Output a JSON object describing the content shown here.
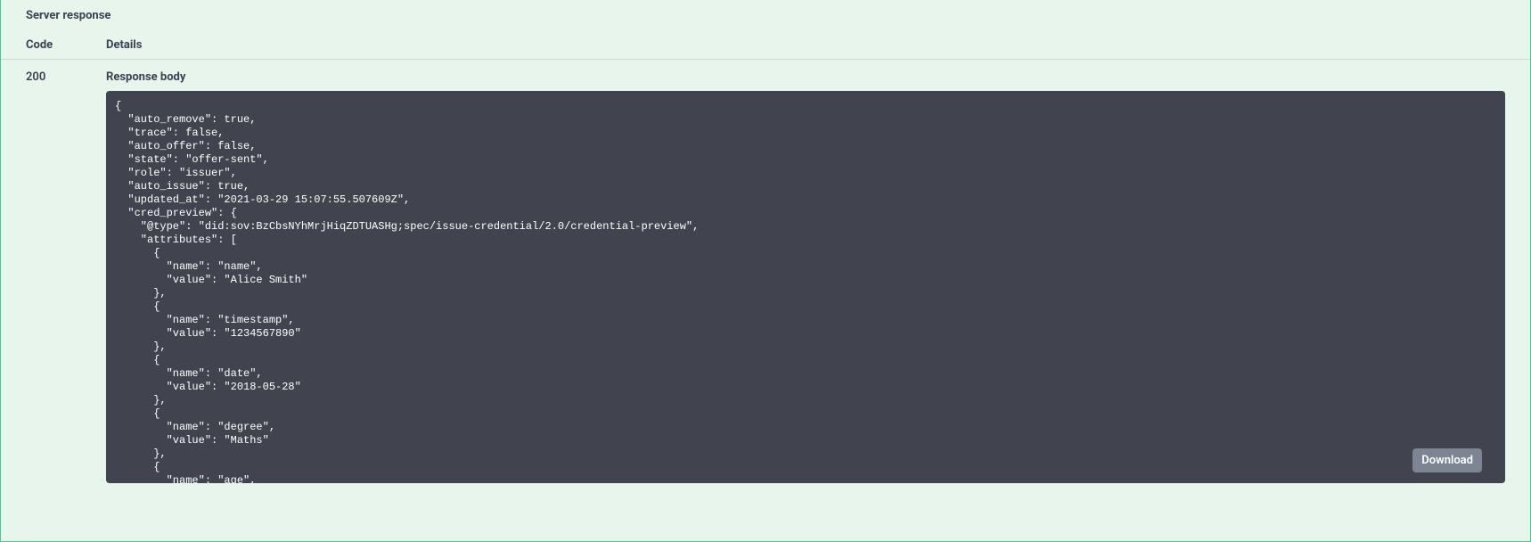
{
  "section_title": "Server response",
  "columns": {
    "code": "Code",
    "details": "Details"
  },
  "response": {
    "code": "200",
    "body_label": "Response body",
    "download_label": "Download",
    "body_json": "{\n  \"auto_remove\": true,\n  \"trace\": false,\n  \"auto_offer\": false,\n  \"state\": \"offer-sent\",\n  \"role\": \"issuer\",\n  \"auto_issue\": true,\n  \"updated_at\": \"2021-03-29 15:07:55.507609Z\",\n  \"cred_preview\": {\n    \"@type\": \"did:sov:BzCbsNYhMrjHiqZDTUASHg;spec/issue-credential/2.0/credential-preview\",\n    \"attributes\": [\n      {\n        \"name\": \"name\",\n        \"value\": \"Alice Smith\"\n      },\n      {\n        \"name\": \"timestamp\",\n        \"value\": \"1234567890\"\n      },\n      {\n        \"name\": \"date\",\n        \"value\": \"2018-05-28\"\n      },\n      {\n        \"name\": \"degree\",\n        \"value\": \"Maths\"\n      },\n      {\n        \"name\": \"age\","
  }
}
